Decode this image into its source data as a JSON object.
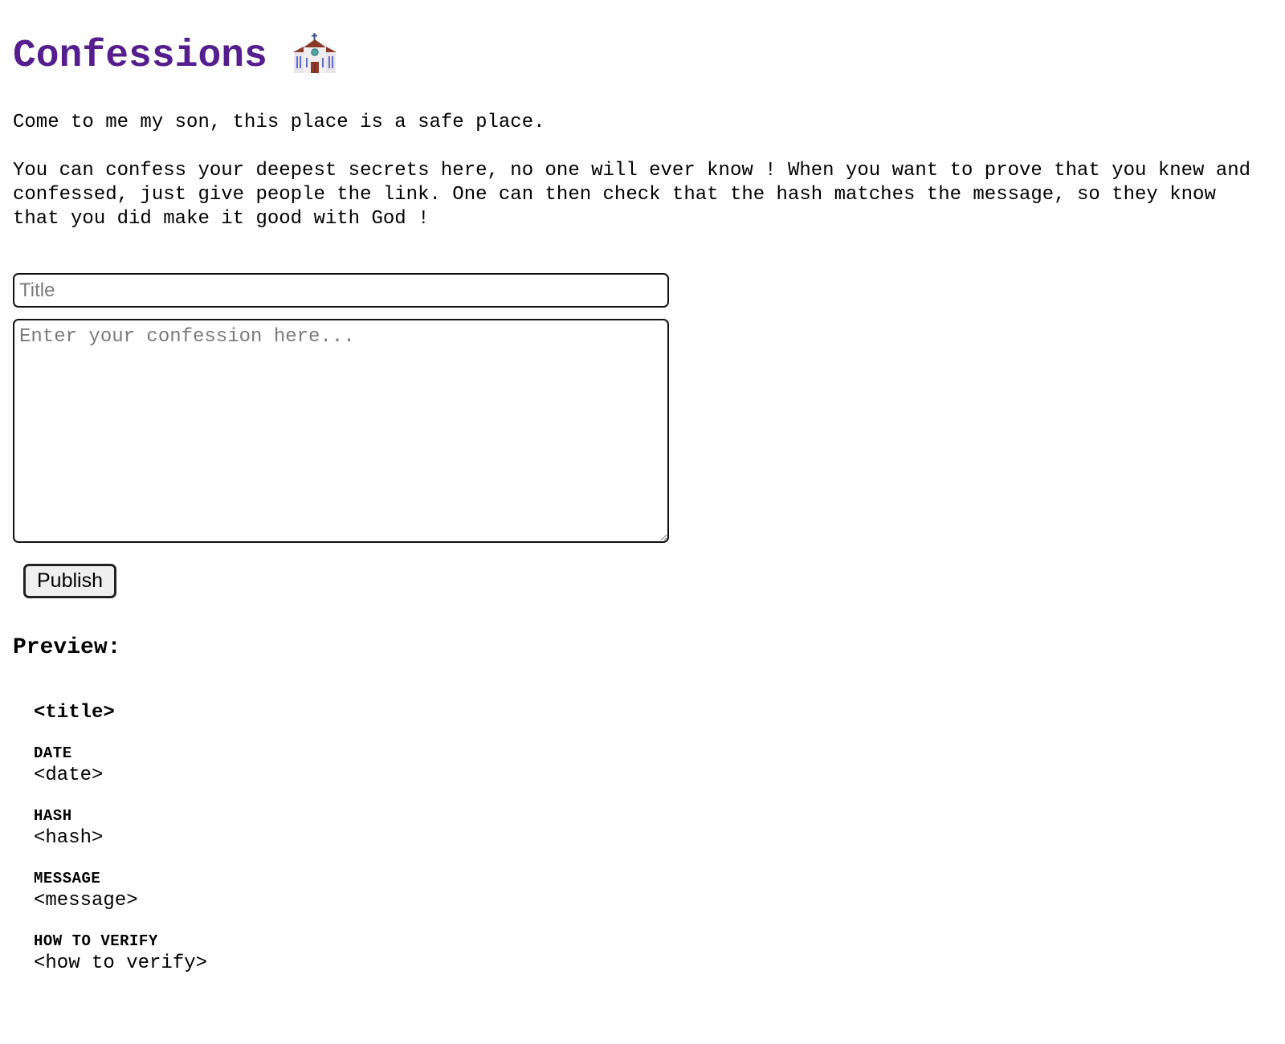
{
  "header": {
    "title": "Confessions",
    "icon": "church-icon"
  },
  "intro": {
    "line1": "Come to me my son, this place is a safe place.",
    "paragraph2": "You can confess your deepest secrets here, no one will ever know ! When you want to prove that you knew and confessed, just give people the link. One can then check that the hash matches the message, so they know that you did make it good with God !"
  },
  "form": {
    "title_placeholder": "Title",
    "title_value": "",
    "message_placeholder": "Enter your confession here...",
    "message_value": "",
    "publish_label": "Publish"
  },
  "preview": {
    "heading": "Preview:",
    "title": "<title>",
    "fields": [
      {
        "label": "DATE",
        "value": "<date>"
      },
      {
        "label": "HASH",
        "value": "<hash>"
      },
      {
        "label": "MESSAGE",
        "value": "<message>"
      },
      {
        "label": "HOW TO VERIFY",
        "value": "<how to verify>"
      }
    ]
  },
  "colors": {
    "title": "#561d8f",
    "text": "#000000",
    "button_bg": "#efefef"
  }
}
